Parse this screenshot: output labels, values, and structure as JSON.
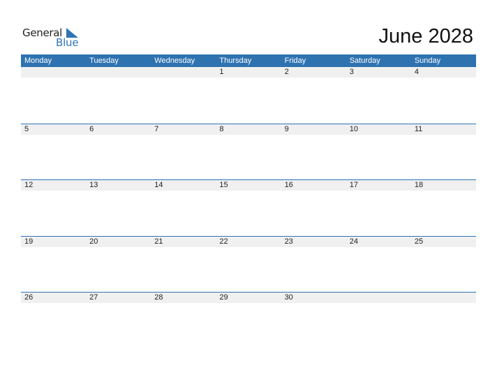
{
  "logo": {
    "line1": "General",
    "line2": "Blue",
    "icon": "triangle-flag-icon",
    "brand_color": "#2e75b6"
  },
  "title": "June 2028",
  "colors": {
    "header_bg": "#2e72b0",
    "header_text": "#ffffff",
    "date_strip_bg": "#f0f0f0",
    "row_border": "#2e72b0"
  },
  "weekdays": [
    "Monday",
    "Tuesday",
    "Wednesday",
    "Thursday",
    "Friday",
    "Saturday",
    "Sunday"
  ],
  "weeks": [
    [
      "",
      "",
      "",
      "1",
      "2",
      "3",
      "4"
    ],
    [
      "5",
      "6",
      "7",
      "8",
      "9",
      "10",
      "11"
    ],
    [
      "12",
      "13",
      "14",
      "15",
      "16",
      "17",
      "18"
    ],
    [
      "19",
      "20",
      "21",
      "22",
      "23",
      "24",
      "25"
    ],
    [
      "26",
      "27",
      "28",
      "29",
      "30",
      "",
      ""
    ]
  ]
}
